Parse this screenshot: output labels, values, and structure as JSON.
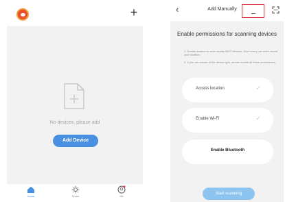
{
  "home": {
    "add_button_icon": "+",
    "empty_message": "No devices, please add",
    "add_device_label": "Add Device",
    "nav": [
      {
        "label": "Home",
        "icon": "home-icon",
        "active": true
      },
      {
        "label": "Smart",
        "icon": "sun-icon",
        "active": false
      },
      {
        "label": "Me",
        "icon": "profile-icon",
        "active": false
      }
    ],
    "colors": {
      "accent": "#4a90e2",
      "logo": "#e8502b",
      "background": "#f2f2f2"
    }
  },
  "add_manually": {
    "back_icon": "‹",
    "title": "Add Manually",
    "panel_title": "Enable permissions for scanning devices",
    "note_1": "1. Enable location to scan nearby Wi-Fi devices. Don't worry, we won't record your location.",
    "note_2": "2. If you are unsure of the device type, please enable all these permissions.",
    "permissions": [
      {
        "label": "Access location",
        "checked": true
      },
      {
        "label": "Enable Wi-Fi",
        "checked": true
      },
      {
        "label": "Enable Bluetooth",
        "checked": false
      }
    ],
    "check_icon": "✓",
    "start_scanning_label": "Start scanning",
    "colors": {
      "highlight": "#e04040",
      "button": "#8ec5f0"
    }
  }
}
